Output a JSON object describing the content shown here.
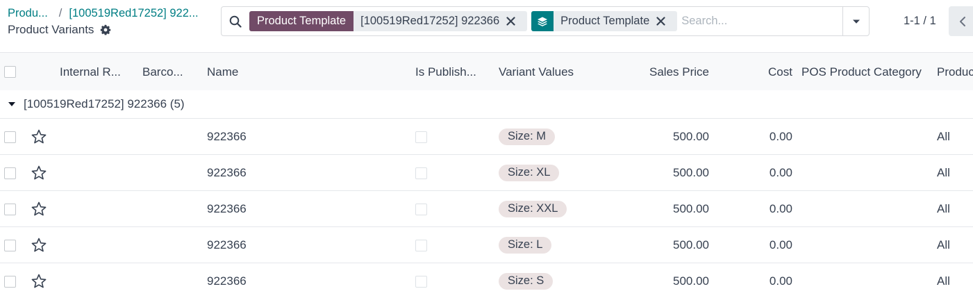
{
  "breadcrumb": {
    "items": [
      "Produ...",
      "[100519Red17252] 922..."
    ],
    "separator": "/"
  },
  "page": {
    "title": "Product Variants"
  },
  "search": {
    "facets": [
      {
        "label": "Product Template",
        "value": "[100519Red17252] 922366",
        "color": "#714b67"
      },
      {
        "icon": "layers-icon",
        "value": "Product Template",
        "color": "#017e84"
      }
    ],
    "placeholder": "Search..."
  },
  "pager": {
    "value": "1-1 / 1"
  },
  "table": {
    "columns": {
      "internal_ref": "Internal R...",
      "barcode": "Barco...",
      "name": "Name",
      "is_published": "Is Publish...",
      "variant_values": "Variant Values",
      "sales_price": "Sales Price",
      "cost": "Cost",
      "pos_category": "POS Product Category",
      "product_category": "Produc"
    },
    "group": {
      "label": "[100519Red17252] 922366 (5)"
    },
    "rows": [
      {
        "name": "922366",
        "variant": "Size: M",
        "sales_price": "500.00",
        "cost": "0.00",
        "product_category": "All"
      },
      {
        "name": "922366",
        "variant": "Size: XL",
        "sales_price": "500.00",
        "cost": "0.00",
        "product_category": "All"
      },
      {
        "name": "922366",
        "variant": "Size: XXL",
        "sales_price": "500.00",
        "cost": "0.00",
        "product_category": "All"
      },
      {
        "name": "922366",
        "variant": "Size: L",
        "sales_price": "500.00",
        "cost": "0.00",
        "product_category": "All"
      },
      {
        "name": "922366",
        "variant": "Size: S",
        "sales_price": "500.00",
        "cost": "0.00",
        "product_category": "All"
      }
    ]
  }
}
